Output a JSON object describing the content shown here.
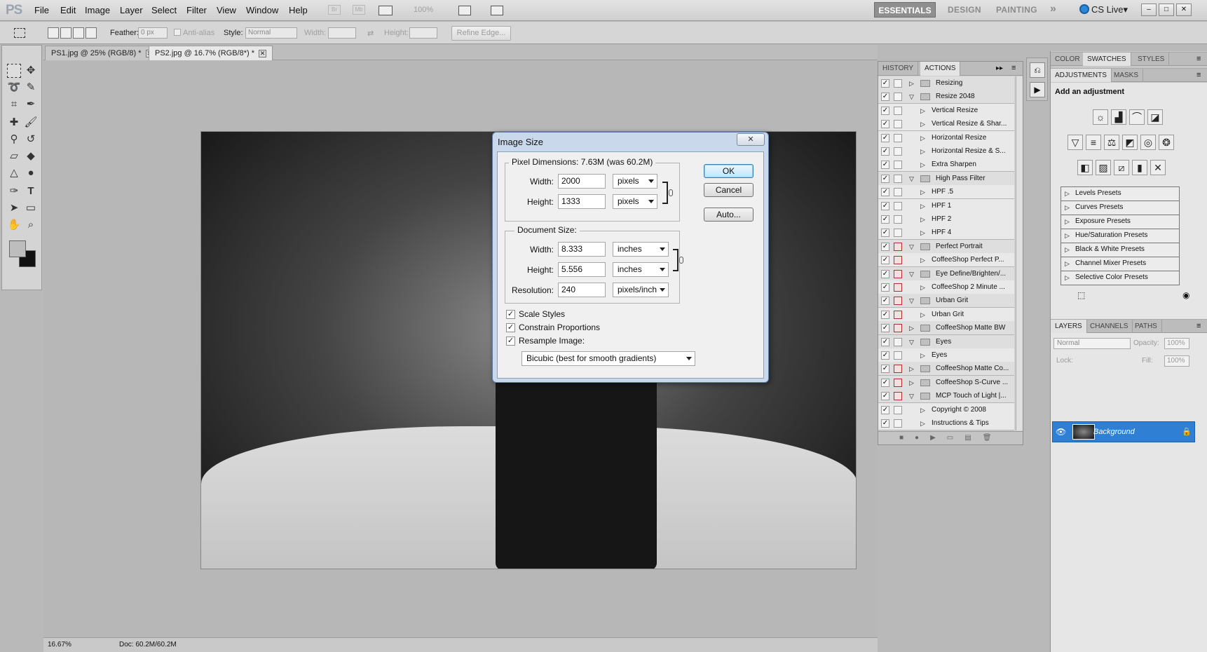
{
  "app": {
    "logo": "PS"
  },
  "menu": [
    "File",
    "Edit",
    "Image",
    "Layer",
    "Select",
    "Filter",
    "View",
    "Window",
    "Help"
  ],
  "menubar": {
    "icon_br": "Br",
    "icon_mb": "Mb",
    "zoom": "100%",
    "workspaces": {
      "active": "ESSENTIALS",
      "design": "DESIGN",
      "painting": "PAINTING",
      "more": "»"
    },
    "cs_live": "CS Live▾",
    "window_controls": {
      "minimize": "–",
      "maximize": "□",
      "close": "✕"
    }
  },
  "options": {
    "feather_label": "Feather:",
    "feather_value": "0 px",
    "antialias_label": "Anti-alias",
    "style_label": "Style:",
    "style_value": "Normal",
    "width_label": "Width:",
    "height_label": "Height:",
    "refine_edge": "Refine Edge..."
  },
  "tabs": [
    {
      "label": "PS1.jpg @ 25% (RGB/8) *",
      "close": "✕"
    },
    {
      "label": "PS2.jpg @ 16.7% (RGB/8*) *",
      "close": "✕"
    }
  ],
  "dialog": {
    "title": "Image Size",
    "close": "✕",
    "pixel_dimensions": "Pixel Dimensions:  7.63M (was 60.2M)",
    "px_width_label": "Width:",
    "px_width": "2000",
    "px_width_unit": "pixels",
    "px_height_label": "Height:",
    "px_height": "1333",
    "px_height_unit": "pixels",
    "document_size": "Document Size:",
    "doc_width_label": "Width:",
    "doc_width": "8.333",
    "doc_width_unit": "inches",
    "doc_height_label": "Height:",
    "doc_height": "5.556",
    "doc_height_unit": "inches",
    "resolution_label": "Resolution:",
    "resolution": "240",
    "resolution_unit": "pixels/inch",
    "scale_styles": "Scale Styles",
    "constrain": "Constrain Proportions",
    "resample": "Resample Image:",
    "resample_method": "Bicubic (best for smooth gradients)",
    "ok": "OK",
    "cancel": "Cancel",
    "auto": "Auto...",
    "check_mark": "✓"
  },
  "actions_panel": {
    "tab_history": "HISTORY",
    "tab_actions": "ACTIONS",
    "check": "✓",
    "tri_collapsed": "▷",
    "tri_expanded": "▽",
    "rows": [
      {
        "label": "Resizing",
        "level": 0,
        "expanded": false,
        "red": false
      },
      {
        "label": "Resize 2048",
        "level": 0,
        "expanded": true,
        "red": false
      },
      {
        "label": "Vertical Resize",
        "level": 1,
        "expanded": false,
        "red": false
      },
      {
        "label": "Vertical Resize & Shar...",
        "level": 1,
        "expanded": false,
        "red": false
      },
      {
        "label": "Horizontal Resize",
        "level": 1,
        "expanded": false,
        "red": false
      },
      {
        "label": "Horizontal Resize & S...",
        "level": 1,
        "expanded": false,
        "red": false
      },
      {
        "label": "Extra Sharpen",
        "level": 1,
        "expanded": false,
        "red": false
      },
      {
        "label": "High Pass Filter",
        "level": 0,
        "expanded": true,
        "red": false
      },
      {
        "label": "HPF .5",
        "level": 1,
        "expanded": false,
        "red": false
      },
      {
        "label": "HPF 1",
        "level": 1,
        "expanded": false,
        "red": false
      },
      {
        "label": "HPF 2",
        "level": 1,
        "expanded": false,
        "red": false
      },
      {
        "label": "HPF 4",
        "level": 1,
        "expanded": false,
        "red": false
      },
      {
        "label": "Perfect Portrait",
        "level": 0,
        "expanded": true,
        "red": true
      },
      {
        "label": "CoffeeShop Perfect P...",
        "level": 1,
        "expanded": false,
        "red": true
      },
      {
        "label": "Eye Define/Brighten/...",
        "level": 0,
        "expanded": true,
        "red": true
      },
      {
        "label": "CoffeeShop 2 Minute ...",
        "level": 1,
        "expanded": false,
        "red": true
      },
      {
        "label": "Urban Grit",
        "level": 0,
        "expanded": true,
        "red": true
      },
      {
        "label": "Urban Grit",
        "level": 1,
        "expanded": false,
        "red": true
      },
      {
        "label": "CoffeeShop Matte BW",
        "level": 0,
        "expanded": false,
        "red": true
      },
      {
        "label": "Eyes",
        "level": 0,
        "expanded": true,
        "red": false
      },
      {
        "label": "Eyes",
        "level": 1,
        "expanded": false,
        "red": false
      },
      {
        "label": "CoffeeShop Matte Co...",
        "level": 0,
        "expanded": false,
        "red": true
      },
      {
        "label": "CoffeeShop S-Curve ...",
        "level": 0,
        "expanded": false,
        "red": true
      },
      {
        "label": "MCP Touch of Light |...",
        "level": 0,
        "expanded": true,
        "red": true
      },
      {
        "label": "Copyright © 2008",
        "level": 1,
        "expanded": false,
        "red": false
      },
      {
        "label": "Instructions & Tips",
        "level": 1,
        "expanded": false,
        "red": false
      }
    ]
  },
  "right": {
    "tabs_top": [
      "COLOR",
      "SWATCHES",
      "STYLES"
    ],
    "tabs_adj": [
      "ADJUSTMENTS",
      "MASKS"
    ],
    "add_adjustment": "Add an adjustment",
    "presets": [
      "Levels Presets",
      "Curves Presets",
      "Exposure Presets",
      "Hue/Saturation Presets",
      "Black & White Presets",
      "Channel Mixer Presets",
      "Selective Color Presets"
    ],
    "tabs_layers": [
      "LAYERS",
      "CHANNELS",
      "PATHS"
    ],
    "blend_mode": "Normal",
    "opacity_label": "Opacity:",
    "opacity": "100%",
    "lock_label": "Lock:",
    "fill_label": "Fill:",
    "fill": "100%",
    "layer_name": "Background"
  },
  "status": {
    "zoom": "16.67%",
    "doc": "Doc: 60.2M/60.2M"
  }
}
